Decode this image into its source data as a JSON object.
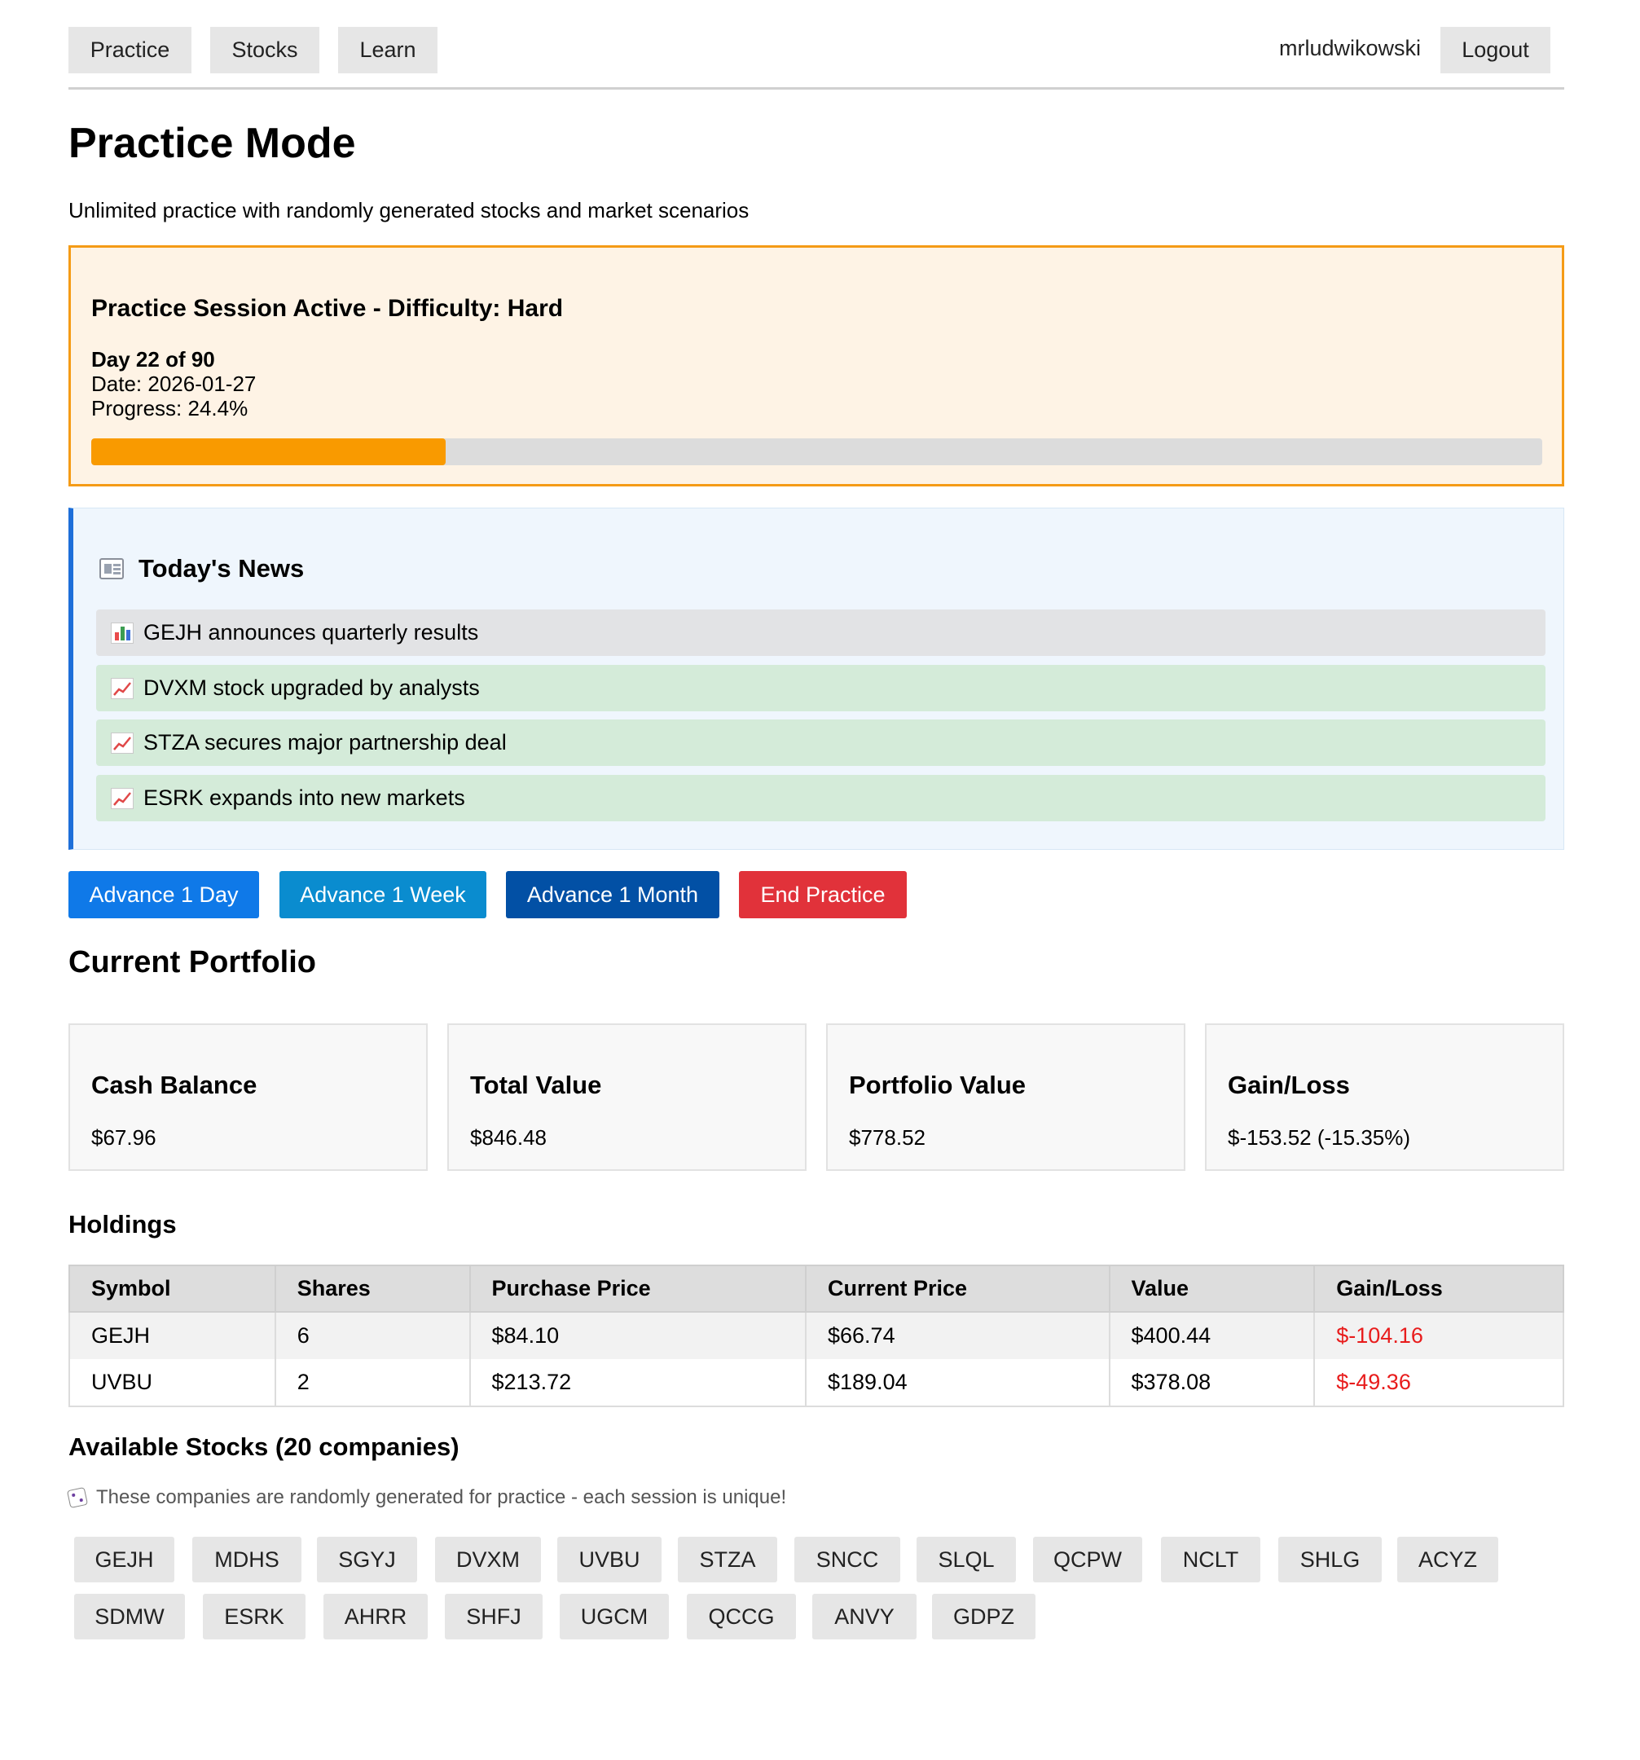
{
  "nav": {
    "items": [
      "Practice",
      "Stocks",
      "Learn"
    ],
    "username": "mrludwikowski",
    "logout_label": "Logout"
  },
  "page": {
    "title": "Practice Mode",
    "subtitle": "Unlimited practice with randomly generated stocks and market scenarios"
  },
  "session": {
    "heading": "Practice Session Active - Difficulty: Hard",
    "day": "Day 22 of 90",
    "date": "Date: 2026-01-27",
    "progress_text": "Progress: 24.4%",
    "progress_percent": 24.4,
    "accent_color": "#f99a00"
  },
  "news": {
    "heading": "Today's News",
    "icon": "newspaper-icon",
    "items": [
      {
        "icon": "bar-chart-icon",
        "text": "GEJH announces quarterly results",
        "tone": "neutral"
      },
      {
        "icon": "chart-increasing-icon",
        "text": "DVXM stock upgraded by analysts",
        "tone": "positive"
      },
      {
        "icon": "chart-increasing-icon",
        "text": "STZA secures major partnership deal",
        "tone": "positive"
      },
      {
        "icon": "chart-increasing-icon",
        "text": "ESRK expands into new markets",
        "tone": "positive"
      }
    ]
  },
  "actions": {
    "advance_day": "Advance 1 Day",
    "advance_week": "Advance 1 Week",
    "advance_month": "Advance 1 Month",
    "end_practice": "End Practice",
    "colors": {
      "day": "#0f79e8",
      "week": "#0a8ccf",
      "month": "#0250a5",
      "end": "#e1323a"
    }
  },
  "portfolio": {
    "heading": "Current Portfolio",
    "cards": [
      {
        "label": "Cash Balance",
        "value": "$67.96"
      },
      {
        "label": "Total Value",
        "value": "$846.48"
      },
      {
        "label": "Portfolio Value",
        "value": "$778.52"
      },
      {
        "label": "Gain/Loss",
        "value": "$-153.52 (-15.35%)"
      }
    ]
  },
  "holdings": {
    "heading": "Holdings",
    "columns": [
      "Symbol",
      "Shares",
      "Purchase Price",
      "Current Price",
      "Value",
      "Gain/Loss"
    ],
    "rows": [
      [
        "GEJH",
        "6",
        "$84.10",
        "$66.74",
        "$400.44",
        "$-104.16"
      ],
      [
        "UVBU",
        "2",
        "$213.72",
        "$189.04",
        "$378.08",
        "$-49.36"
      ]
    ],
    "negative_color": "#e81c1c"
  },
  "available": {
    "heading": "Available Stocks (20 companies)",
    "note": "These companies are randomly generated for practice - each session is unique!",
    "note_icon": "dice-icon",
    "symbols": [
      "GEJH",
      "MDHS",
      "SGYJ",
      "DVXM",
      "UVBU",
      "STZA",
      "SNCC",
      "SLQL",
      "QCPW",
      "NCLT",
      "SHLG",
      "ACYZ",
      "SDMW",
      "ESRK",
      "AHRR",
      "SHFJ",
      "UGCM",
      "QCCG",
      "ANVY",
      "GDPZ"
    ]
  }
}
